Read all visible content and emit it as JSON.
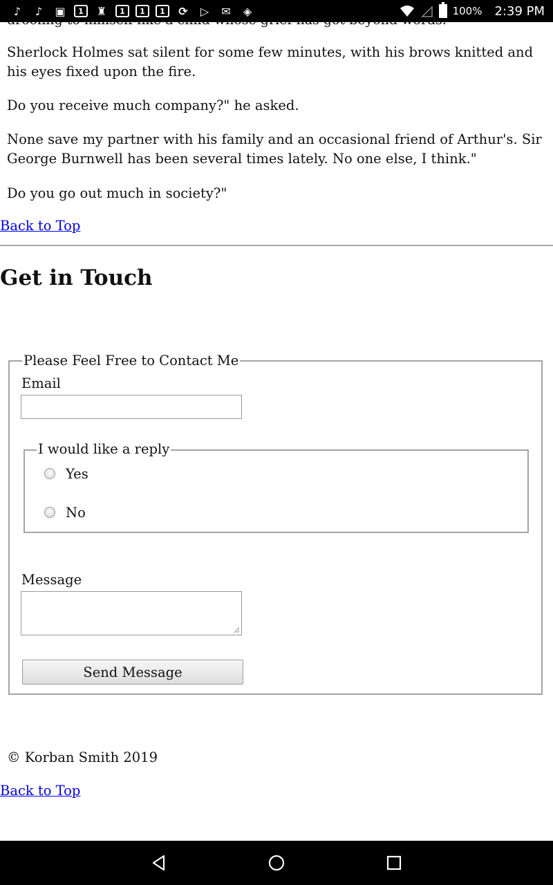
{
  "status_bar": {
    "battery_percent": "100%",
    "time": "2:39 PM",
    "left_icons": [
      "tiktok-icon",
      "tiktok-icon",
      "app-icon",
      "calendar-icon",
      "keyhole-icon",
      "calendar-icon",
      "calendar-icon",
      "calendar-icon",
      "sync-icon",
      "play-store-icon",
      "mail-icon",
      "maps-icon"
    ]
  },
  "article": {
    "clipped_top_line": "drooling to himself like a child whose grief has got beyond words.",
    "paragraphs": [
      "Sherlock Holmes sat silent for some few minutes, with his brows knitted and his eyes fixed upon the fire.",
      "Do you receive much company?\" he asked.",
      "None save my partner with his family and an occasional friend of Arthur's. Sir George Burnwell has been several times lately. No one else, I think.\"",
      "Do you go out much in society?\""
    ],
    "back_to_top": "Back to Top"
  },
  "contact": {
    "heading": "Get in Touch",
    "legend": "Please Feel Free to Contact Me",
    "email_label": "Email",
    "email_value": "",
    "reply_legend": "I would like a reply",
    "reply_options": [
      "Yes",
      "No"
    ],
    "message_label": "Message",
    "message_value": "",
    "send_button": "Send Message"
  },
  "footer": {
    "copyright": "© Korban Smith 2019",
    "back_to_top": "Back to Top"
  }
}
